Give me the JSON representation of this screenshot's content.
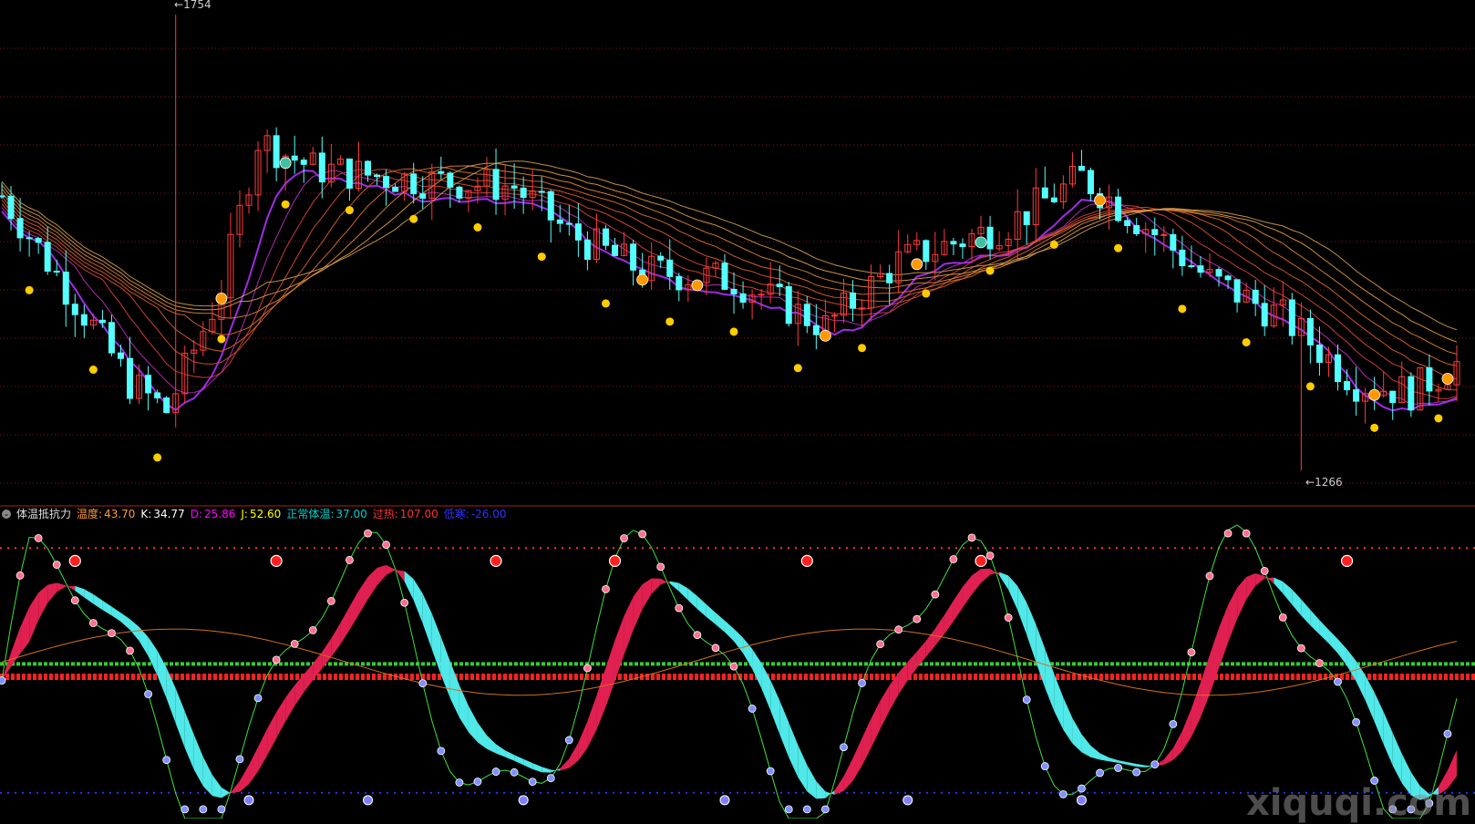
{
  "legend": {
    "title": "体温抵抗力",
    "items": [
      {
        "label": "温度:",
        "value": "43.70",
        "color": "#ff9933"
      },
      {
        "label": "K:",
        "value": "34.77",
        "color": "#ffffff"
      },
      {
        "label": "D:",
        "value": "25.86",
        "color": "#ff00ff"
      },
      {
        "label": "J:",
        "value": "52.60",
        "color": "#ffff00"
      },
      {
        "label": "正常体温:",
        "value": "37.00",
        "color": "#00cccc"
      },
      {
        "label": "过热:",
        "value": "107.00",
        "color": "#ff3030"
      },
      {
        "label": "低寒:",
        "value": "-26.00",
        "color": "#3030ff"
      }
    ]
  },
  "price_labels": {
    "high": "1754",
    "low": "1266"
  },
  "band_text": "弱弱弱弱弱弱弱弱弱弱弱弱弱弱弱弱弱弱弱弱弱弱弱弱弱弱弱弱弱弱弱弱弱弱弱弱弱弱弱弱弱弱弱弱弱弱弱弱弱弱弱弱弱弱弱弱弱弱弱弱弱弱弱弱弱弱弱弱弱弱",
  "watermark": "xiquqi.com",
  "colors": {
    "up": "#ff3b3b",
    "down": "#54ffff",
    "ribbon_top": "#b030ff",
    "ribbon_mid": "#e04040",
    "ribbon_low": "#e8a040",
    "signal_dot": "#ffcc00",
    "kd_up": "#e02050",
    "kd_down": "#50e8e8",
    "j_line": "#40e040",
    "temp_line": "#d07020",
    "hot_line": "#ff3030",
    "cold_line": "#3030ff",
    "band_red": "#ff2020",
    "band_green": "#40ff40"
  },
  "chart_data": [
    {
      "type": "candlestick",
      "title": "",
      "annotations": [
        "1754",
        "1266"
      ],
      "ylim": [
        1230,
        1760
      ],
      "highest_high": 1754,
      "lowest_low": 1266
    },
    {
      "type": "line",
      "title": "体温抵抗力",
      "series": [
        {
          "name": "温度",
          "last": 43.7
        },
        {
          "name": "K",
          "last": 34.77
        },
        {
          "name": "D",
          "last": 25.86
        },
        {
          "name": "J",
          "last": 52.6
        },
        {
          "name": "正常体温",
          "last": 37.0
        },
        {
          "name": "过热",
          "last": 107.0
        },
        {
          "name": "低寒",
          "last": -26.0
        }
      ]
    }
  ]
}
